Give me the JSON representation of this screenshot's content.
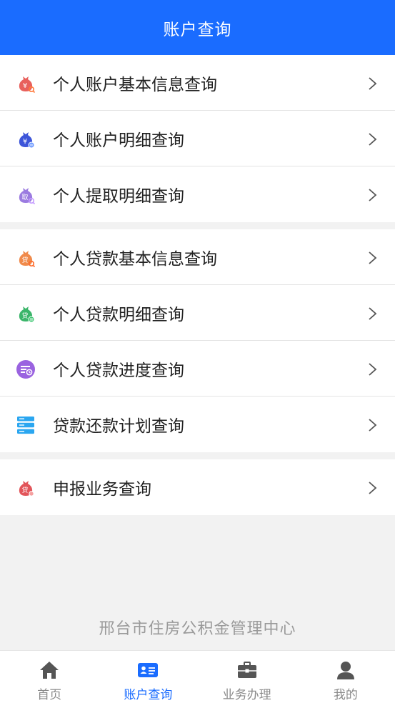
{
  "header": {
    "title": "账户查询"
  },
  "colors": {
    "accent": "#1a6cff",
    "background": "#f2f2f2"
  },
  "groups": [
    {
      "items": [
        {
          "label": "个人账户基本信息查询",
          "icon": "account-info-icon"
        },
        {
          "label": "个人账户明细查询",
          "icon": "account-detail-icon"
        },
        {
          "label": "个人提取明细查询",
          "icon": "withdraw-detail-icon"
        }
      ]
    },
    {
      "items": [
        {
          "label": "个人贷款基本信息查询",
          "icon": "loan-info-icon"
        },
        {
          "label": "个人贷款明细查询",
          "icon": "loan-detail-icon"
        },
        {
          "label": "个人贷款进度查询",
          "icon": "loan-progress-icon"
        },
        {
          "label": "贷款还款计划查询",
          "icon": "repayment-plan-icon"
        }
      ]
    },
    {
      "items": [
        {
          "label": "申报业务查询",
          "icon": "declaration-icon"
        }
      ]
    }
  ],
  "footer": {
    "organization": "邢台市住房公积金管理中心"
  },
  "tabbar": {
    "active": "账户查询",
    "tabs": [
      {
        "label": "首页",
        "icon": "home-icon"
      },
      {
        "label": "账户查询",
        "icon": "id-card-icon"
      },
      {
        "label": "业务办理",
        "icon": "briefcase-icon"
      },
      {
        "label": "我的",
        "icon": "user-icon"
      }
    ]
  },
  "icon_glyphs": {
    "account": "¥",
    "withdraw": "取",
    "loan": "贷"
  }
}
